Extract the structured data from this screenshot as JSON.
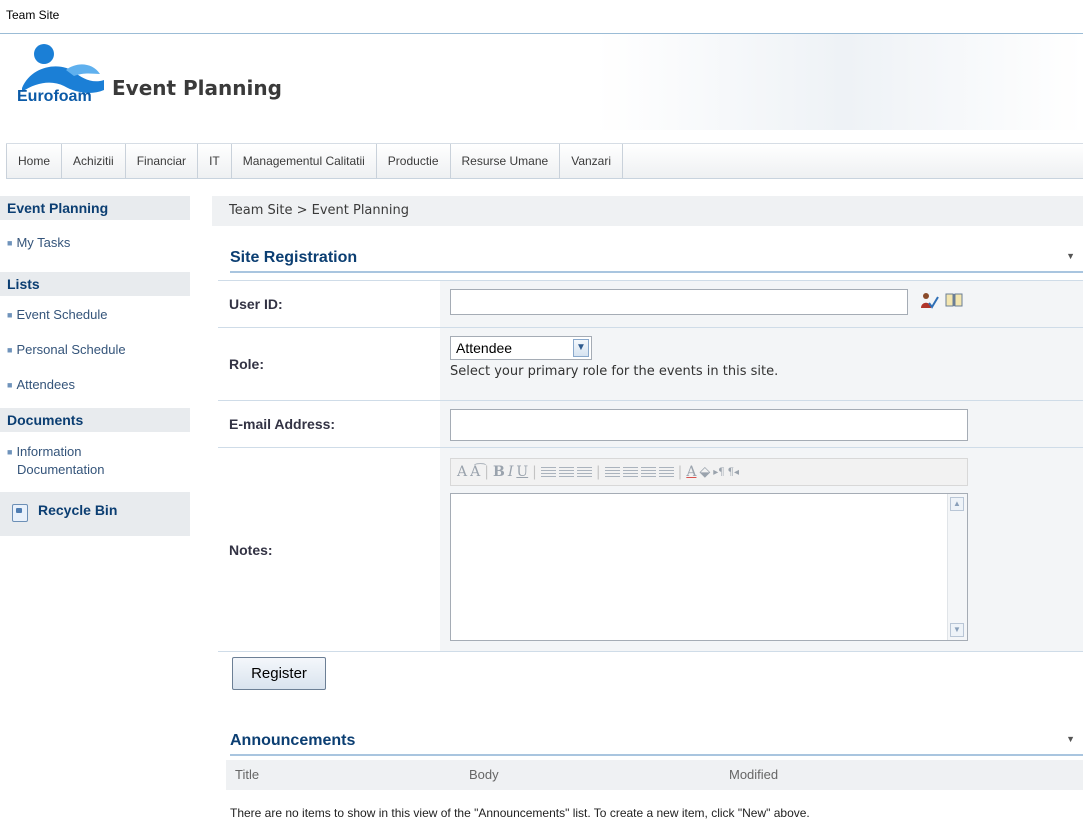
{
  "top": {
    "site_link": "Team Site"
  },
  "header": {
    "logo_text": "Eurofoam",
    "site_title": "Event Planning"
  },
  "nav": {
    "items": [
      "Home",
      "Achizitii",
      "Financiar",
      "IT",
      "Managementul Calitatii",
      "Productie",
      "Resurse Umane",
      "Vanzari"
    ]
  },
  "leftnav": {
    "event_planning": "Event Planning",
    "my_tasks": "My Tasks",
    "lists": "Lists",
    "event_schedule": "Event Schedule",
    "personal_schedule": "Personal Schedule",
    "attendees": "Attendees",
    "documents": "Documents",
    "information_documentation": "Information Documentation",
    "recycle_bin": "Recycle Bin"
  },
  "breadcrumb": "Team Site > Event Planning",
  "registration": {
    "title": "Site Registration",
    "user_id_label": "User ID:",
    "user_id_value": "",
    "role_label": "Role:",
    "role_value": "Attendee",
    "role_hint": "Select your primary role for the events in this site.",
    "email_label": "E-mail Address:",
    "email_value": "",
    "notes_label": "Notes:",
    "notes_value": "",
    "register_label": "Register"
  },
  "announcements": {
    "title": "Announcements",
    "columns": [
      "Title",
      "Body",
      "Modified"
    ],
    "empty_message": "There are no items to show in this view of the \"Announcements\" list. To create a new item, click \"New\" above."
  },
  "colors": {
    "heading": "#0b3e72",
    "link": "#34547a",
    "accent_border": "#a9c5df",
    "brand": "#0b5aa7"
  }
}
